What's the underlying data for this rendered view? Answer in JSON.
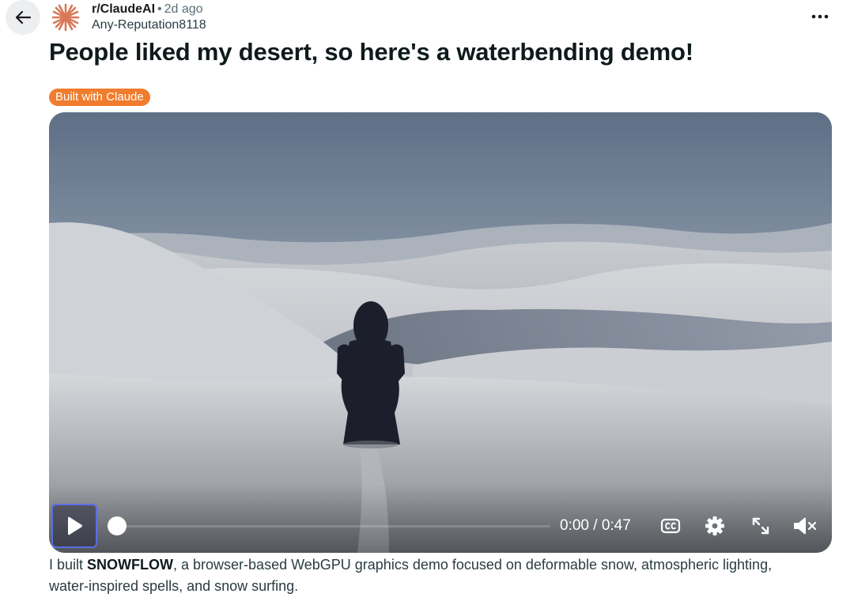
{
  "post": {
    "subreddit": "r/ClaudeAI",
    "separator": "•",
    "age": "2d ago",
    "author": "Any-Reputation8118",
    "title": "People liked my desert, so here's a waterbending demo!",
    "flair": "Built with Claude",
    "flair_color": "#f07c2d",
    "body_prefix": "I built ",
    "body_bold": "SNOWFLOW",
    "body_suffix": ", a browser-based WebGPU graphics demo focused on deformable snow, atmospheric lighting, water-inspired spells, and snow surfing."
  },
  "icons": {
    "back": "arrow-left-icon",
    "avatar": "claude-asterisk-icon",
    "more": "ellipsis-icon",
    "play": "play-icon",
    "cc": "closed-captions-icon",
    "settings": "gear-icon",
    "fullscreen": "expand-icon",
    "mute": "volume-muted-icon"
  },
  "video": {
    "timecode": "0:00 / 0:47",
    "progress": 0.0
  },
  "colors": {
    "accent": "#d97757",
    "focus_ring": "#5b6ee6"
  }
}
